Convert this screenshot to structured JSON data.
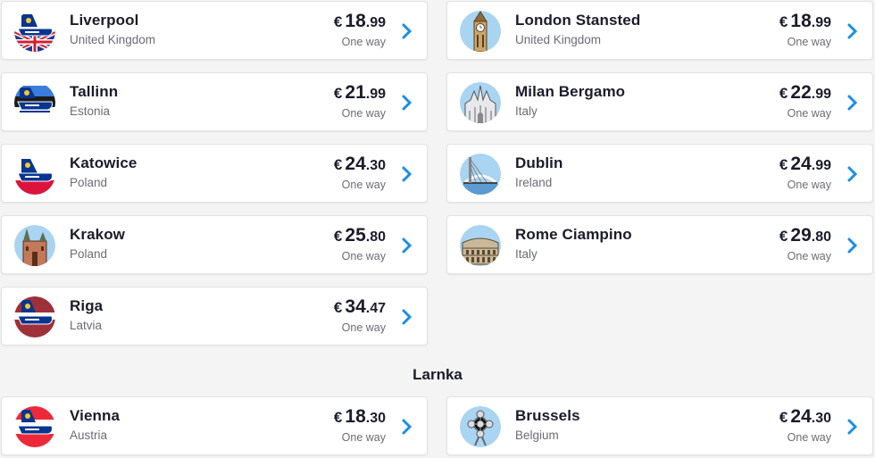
{
  "section_title": "Larnka",
  "flights": [
    {
      "city": "Liverpool",
      "country": "United Kingdom",
      "currency": "€",
      "price_int": "18",
      "price_dec": ".99",
      "note": "One way",
      "icon": "ryanair-plane-uk-flag-icon"
    },
    {
      "city": "London Stansted",
      "country": "United Kingdom",
      "currency": "€",
      "price_int": "18",
      "price_dec": ".99",
      "note": "One way",
      "icon": "big-ben-icon"
    },
    {
      "city": "Tallinn",
      "country": "Estonia",
      "currency": "€",
      "price_int": "21",
      "price_dec": ".99",
      "note": "One way",
      "icon": "ryanair-plane-estonia-flag-icon"
    },
    {
      "city": "Milan Bergamo",
      "country": "Italy",
      "currency": "€",
      "price_int": "22",
      "price_dec": ".99",
      "note": "One way",
      "icon": "milan-cathedral-icon"
    },
    {
      "city": "Katowice",
      "country": "Poland",
      "currency": "€",
      "price_int": "24",
      "price_dec": ".30",
      "note": "One way",
      "icon": "ryanair-plane-poland-flag-icon"
    },
    {
      "city": "Dublin",
      "country": "Ireland",
      "currency": "€",
      "price_int": "24",
      "price_dec": ".99",
      "note": "One way",
      "icon": "dublin-bridge-icon"
    },
    {
      "city": "Krakow",
      "country": "Poland",
      "currency": "€",
      "price_int": "25",
      "price_dec": ".80",
      "note": "One way",
      "icon": "krakow-church-icon"
    },
    {
      "city": "Rome Ciampino",
      "country": "Italy",
      "currency": "€",
      "price_int": "29",
      "price_dec": ".80",
      "note": "One way",
      "icon": "colosseum-icon"
    },
    {
      "city": "Riga",
      "country": "Latvia",
      "currency": "€",
      "price_int": "34",
      "price_dec": ".47",
      "note": "One way",
      "icon": "ryanair-plane-latvia-flag-icon"
    },
    {
      "city": "Vienna",
      "country": "Austria",
      "currency": "€",
      "price_int": "18",
      "price_dec": ".30",
      "note": "One way",
      "icon": "ryanair-plane-austria-flag-icon"
    },
    {
      "city": "Brussels",
      "country": "Belgium",
      "currency": "€",
      "price_int": "24",
      "price_dec": ".30",
      "note": "One way",
      "icon": "atomium-icon"
    }
  ],
  "colors": {
    "background": "#f4f4f4",
    "card": "#ffffff",
    "chevron": "#1a8fe3",
    "ryanair_blue": "#073590",
    "ryanair_yellow": "#f1c933",
    "landmark_circle": "#a9d4f2"
  }
}
